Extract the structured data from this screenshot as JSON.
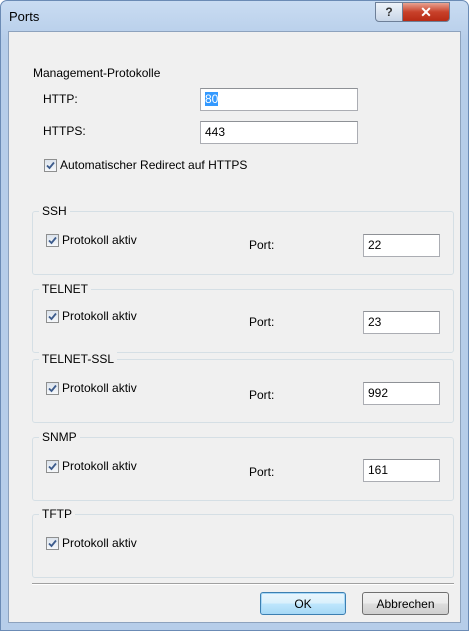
{
  "window": {
    "title": "Ports",
    "help_glyph": "?",
    "close_glyph": "✕"
  },
  "management": {
    "legend": "Management-Protokolle",
    "http_label": "HTTP:",
    "http_value": "80",
    "https_label": "HTTPS:",
    "https_value": "443",
    "redirect_label": "Automatischer Redirect auf HTTPS",
    "redirect_checked": true
  },
  "ssh": {
    "legend": "SSH",
    "active_label": "Protokoll aktiv",
    "port_label": "Port:",
    "port_value": "22"
  },
  "telnet": {
    "legend": "TELNET",
    "active_label": "Protokoll aktiv",
    "port_label": "Port:",
    "port_value": "23"
  },
  "telnet_ssl": {
    "legend": "TELNET-SSL",
    "active_label": "Protokoll aktiv",
    "port_label": "Port:",
    "port_value": "992"
  },
  "snmp": {
    "legend": "SNMP",
    "active_label": "Protokoll aktiv",
    "port_label": "Port:",
    "port_value": "161"
  },
  "tftp": {
    "legend": "TFTP",
    "active_label": "Protokoll aktiv"
  },
  "buttons": {
    "ok": "OK",
    "cancel": "Abbrechen"
  },
  "colors": {
    "selection": "#3399ff",
    "title_gradient": "#b6cde9",
    "close_button": "#c8412a"
  }
}
